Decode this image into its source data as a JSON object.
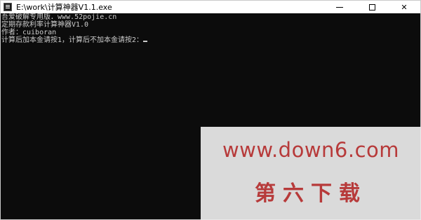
{
  "window": {
    "title": "E:\\work\\计算神器V1.1.exe",
    "controls": {
      "minimize": "—",
      "maximize": "☐",
      "close": "✕"
    }
  },
  "console": {
    "lines": [
      "吾爱破解专用版．www.52pojie.cn",
      "定期存款利率计算神器V1.0",
      "作者：cuiboran",
      "计算后加本金请按1，计算后不加本金请按2："
    ]
  },
  "watermark": {
    "url": "www.down6.com",
    "name": "第六下载"
  },
  "colors": {
    "console_bg": "#0c0c0c",
    "console_text": "#cccccc",
    "watermark_text": "#b73a3a",
    "watermark_bg": "#ebebeb"
  }
}
